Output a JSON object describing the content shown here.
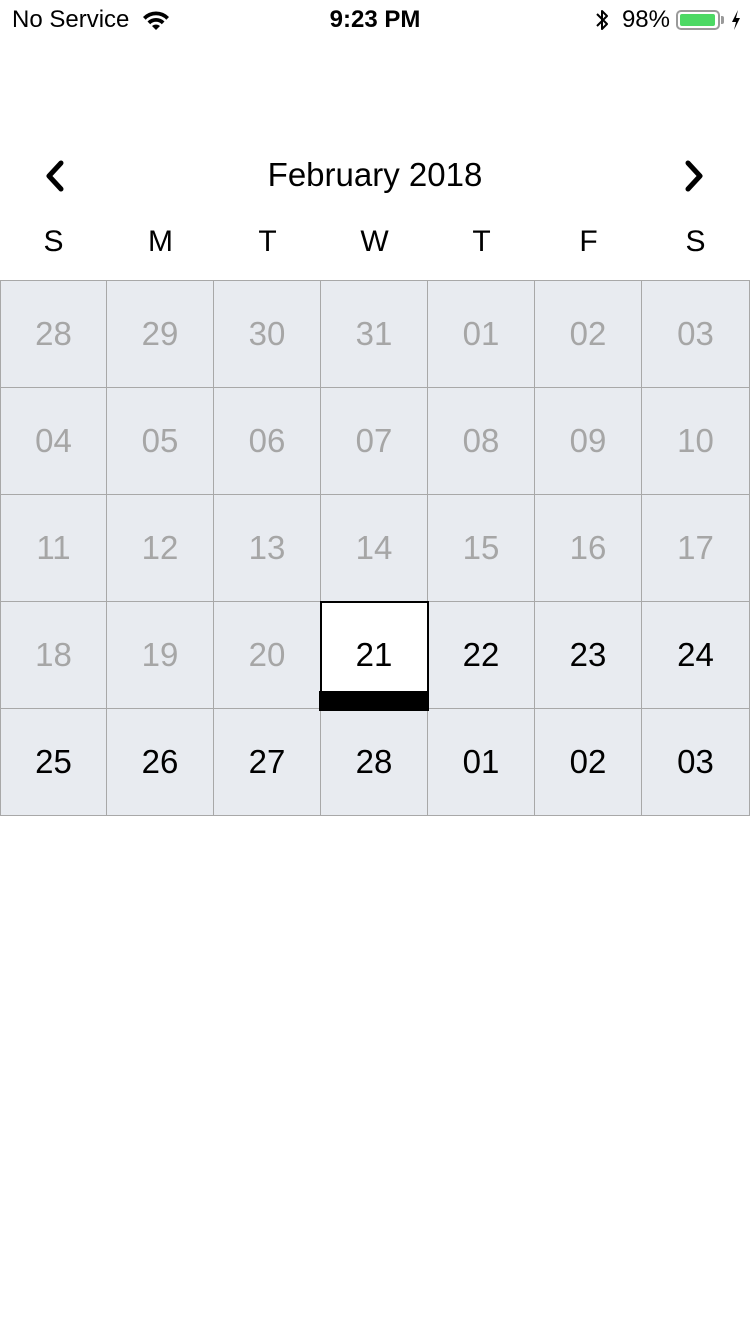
{
  "status_bar": {
    "carrier": "No Service",
    "time": "9:23 PM",
    "battery_percent": "98%",
    "battery_level": 0.98,
    "battery_color": "#4cd964",
    "icons": [
      "wifi-icon",
      "bluetooth-icon",
      "battery-icon",
      "charging-icon"
    ]
  },
  "calendar": {
    "month_title": "February 2018",
    "prev_icon": "chevron-left-icon",
    "next_icon": "chevron-right-icon",
    "weekdays": [
      "S",
      "M",
      "T",
      "W",
      "T",
      "F",
      "S"
    ],
    "selected_day": "21",
    "cell_background": "#e8ebf0",
    "muted_color": "#a6a6a6",
    "weeks": [
      [
        {
          "label": "28",
          "state": "muted"
        },
        {
          "label": "29",
          "state": "muted"
        },
        {
          "label": "30",
          "state": "muted"
        },
        {
          "label": "31",
          "state": "muted"
        },
        {
          "label": "01",
          "state": "muted"
        },
        {
          "label": "02",
          "state": "muted"
        },
        {
          "label": "03",
          "state": "muted"
        }
      ],
      [
        {
          "label": "04",
          "state": "muted"
        },
        {
          "label": "05",
          "state": "muted"
        },
        {
          "label": "06",
          "state": "muted"
        },
        {
          "label": "07",
          "state": "muted"
        },
        {
          "label": "08",
          "state": "muted"
        },
        {
          "label": "09",
          "state": "muted"
        },
        {
          "label": "10",
          "state": "muted"
        }
      ],
      [
        {
          "label": "11",
          "state": "muted"
        },
        {
          "label": "12",
          "state": "muted"
        },
        {
          "label": "13",
          "state": "muted"
        },
        {
          "label": "14",
          "state": "muted"
        },
        {
          "label": "15",
          "state": "muted"
        },
        {
          "label": "16",
          "state": "muted"
        },
        {
          "label": "17",
          "state": "muted"
        }
      ],
      [
        {
          "label": "18",
          "state": "muted"
        },
        {
          "label": "19",
          "state": "muted"
        },
        {
          "label": "20",
          "state": "muted"
        },
        {
          "label": "21",
          "state": "selected"
        },
        {
          "label": "22",
          "state": "active"
        },
        {
          "label": "23",
          "state": "active"
        },
        {
          "label": "24",
          "state": "active"
        }
      ],
      [
        {
          "label": "25",
          "state": "active"
        },
        {
          "label": "26",
          "state": "active"
        },
        {
          "label": "27",
          "state": "active"
        },
        {
          "label": "28",
          "state": "active"
        },
        {
          "label": "01",
          "state": "active"
        },
        {
          "label": "02",
          "state": "active"
        },
        {
          "label": "03",
          "state": "active"
        }
      ]
    ]
  }
}
